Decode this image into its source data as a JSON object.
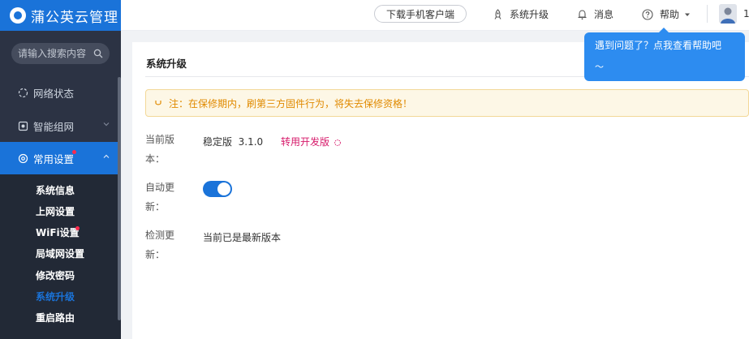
{
  "app": {
    "title": "蒲公英云管理"
  },
  "search": {
    "placeholder": "请输入搜索内容"
  },
  "sidebar": {
    "items": [
      {
        "label": "网络状态",
        "icon": "network-status-icon"
      },
      {
        "label": "智能组网",
        "icon": "smart-network-icon"
      },
      {
        "label": "常用设置",
        "icon": "settings-icon"
      }
    ],
    "submenu": [
      {
        "label": "系统信息"
      },
      {
        "label": "上网设置"
      },
      {
        "label": "WiFi设置"
      },
      {
        "label": "局域网设置"
      },
      {
        "label": "修改密码"
      },
      {
        "label": "系统升级"
      },
      {
        "label": "重启路由"
      }
    ]
  },
  "topbar": {
    "download": "下载手机客户端",
    "upgrade": "系统升级",
    "messages": "消息",
    "help": "帮助",
    "user_prefix": "1"
  },
  "tooltip": {
    "line1": "遇到问题了？点我查看帮助吧",
    "line2": "～"
  },
  "panel": {
    "title": "系统升级",
    "notice": "注：在保修期内，刷第三方固件行为，将失去保修资格！",
    "current_version_label": "当前版本：",
    "current_version_value": "稳定版  3.1.0",
    "switch_dev": "转用开发版",
    "auto_update_label": "自动更新：",
    "auto_update_on": true,
    "check_update_label": "检测更新：",
    "check_update_value": "当前已是最新版本"
  },
  "colors": {
    "accent": "#1a73d9",
    "sidebar": "#2c3344",
    "notice_text": "#e08a00",
    "dev_link": "#d6196a"
  }
}
